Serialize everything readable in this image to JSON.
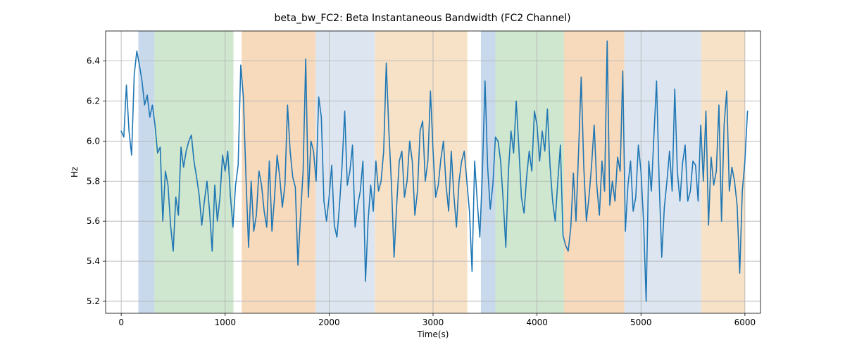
{
  "chart_data": {
    "type": "line",
    "title": "beta_bw_FC2: Beta Instantaneous Bandwidth (FC2 Channel)",
    "xlabel": "Time(s)",
    "ylabel": "Hz",
    "xlim": [
      -150,
      6150
    ],
    "ylim": [
      5.14,
      6.55
    ],
    "xticks": [
      0,
      1000,
      2000,
      3000,
      4000,
      5000,
      6000
    ],
    "yticks": [
      5.2,
      5.4,
      5.6,
      5.8,
      6.0,
      6.2,
      6.4
    ],
    "regions": [
      {
        "x0": 165,
        "x1": 320,
        "color": "#c9d9ec"
      },
      {
        "x0": 320,
        "x1": 1080,
        "color": "#cfe6cf"
      },
      {
        "x0": 1080,
        "x1": 1160,
        "color": "#ffffff"
      },
      {
        "x0": 1160,
        "x1": 1870,
        "color": "#f7d9bc"
      },
      {
        "x0": 1870,
        "x1": 2440,
        "color": "#dde6f0"
      },
      {
        "x0": 2440,
        "x1": 3330,
        "color": "#f7e2c8"
      },
      {
        "x0": 3330,
        "x1": 3460,
        "color": "#ffffff"
      },
      {
        "x0": 3460,
        "x1": 3600,
        "color": "#c9d9ec"
      },
      {
        "x0": 3600,
        "x1": 4260,
        "color": "#cfe6cf"
      },
      {
        "x0": 4260,
        "x1": 4840,
        "color": "#f7d9bc"
      },
      {
        "x0": 4840,
        "x1": 5580,
        "color": "#dde6f0"
      },
      {
        "x0": 5580,
        "x1": 6000,
        "color": "#f7e2c8"
      }
    ],
    "series": [
      {
        "name": "beta_bw_FC2",
        "color": "#1f77b4",
        "x_start": 0,
        "x_step": 25,
        "y": [
          6.05,
          6.02,
          6.28,
          6.05,
          5.93,
          6.33,
          6.45,
          6.38,
          6.3,
          6.18,
          6.23,
          6.12,
          6.18,
          6.08,
          5.94,
          5.97,
          5.6,
          5.85,
          5.78,
          5.58,
          5.45,
          5.72,
          5.63,
          5.97,
          5.87,
          5.95,
          6.0,
          6.03,
          5.9,
          5.82,
          5.73,
          5.58,
          5.7,
          5.8,
          5.65,
          5.45,
          5.78,
          5.6,
          5.72,
          5.93,
          5.85,
          5.95,
          5.73,
          5.57,
          5.78,
          5.88,
          6.38,
          6.22,
          5.82,
          5.47,
          5.8,
          5.55,
          5.63,
          5.85,
          5.78,
          5.65,
          5.57,
          5.9,
          5.55,
          5.72,
          5.93,
          5.82,
          5.67,
          5.78,
          6.18,
          5.95,
          5.82,
          5.77,
          5.38,
          5.63,
          5.85,
          6.41,
          5.72,
          6.0,
          5.95,
          5.8,
          6.22,
          6.12,
          5.7,
          5.6,
          5.72,
          5.88,
          5.58,
          5.52,
          5.68,
          5.88,
          6.15,
          5.78,
          5.85,
          5.98,
          5.57,
          5.68,
          5.75,
          5.9,
          5.3,
          5.6,
          5.78,
          5.65,
          5.9,
          5.75,
          5.8,
          5.95,
          6.39,
          6.05,
          5.78,
          5.42,
          5.68,
          5.9,
          5.95,
          5.72,
          5.8,
          6.0,
          5.9,
          5.63,
          5.75,
          6.05,
          6.1,
          5.8,
          5.9,
          6.25,
          5.95,
          5.72,
          5.78,
          5.91,
          6.0,
          5.78,
          5.65,
          5.95,
          5.73,
          5.57,
          5.8,
          5.9,
          5.95,
          5.8,
          5.65,
          5.35,
          5.9,
          5.7,
          5.52,
          5.85,
          6.3,
          5.87,
          5.66,
          5.78,
          6.02,
          6.0,
          5.9,
          5.7,
          5.47,
          5.85,
          6.05,
          5.94,
          6.2,
          5.97,
          5.72,
          5.64,
          5.82,
          5.95,
          5.85,
          6.15,
          6.08,
          5.9,
          6.05,
          5.95,
          6.16,
          5.88,
          5.7,
          5.6,
          5.8,
          5.98,
          5.53,
          5.48,
          5.45,
          5.57,
          5.84,
          5.6,
          5.95,
          6.32,
          5.87,
          5.6,
          5.72,
          5.88,
          6.08,
          5.78,
          5.63,
          5.9,
          5.75,
          6.5,
          5.68,
          5.8,
          5.7,
          5.92,
          5.85,
          6.35,
          5.55,
          5.78,
          5.9,
          5.65,
          5.72,
          5.98,
          5.85,
          5.6,
          5.2,
          5.9,
          5.75,
          6.03,
          6.3,
          5.8,
          5.42,
          5.67,
          5.8,
          5.95,
          5.75,
          6.26,
          5.85,
          5.7,
          5.89,
          5.98,
          5.7,
          5.75,
          5.9,
          5.88,
          5.7,
          6.08,
          5.8,
          6.15,
          5.58,
          5.92,
          5.78,
          5.85,
          6.18,
          5.6,
          6.08,
          6.25,
          5.75,
          5.87,
          5.8,
          5.68,
          5.34,
          5.75,
          5.9,
          6.15
        ]
      }
    ]
  }
}
